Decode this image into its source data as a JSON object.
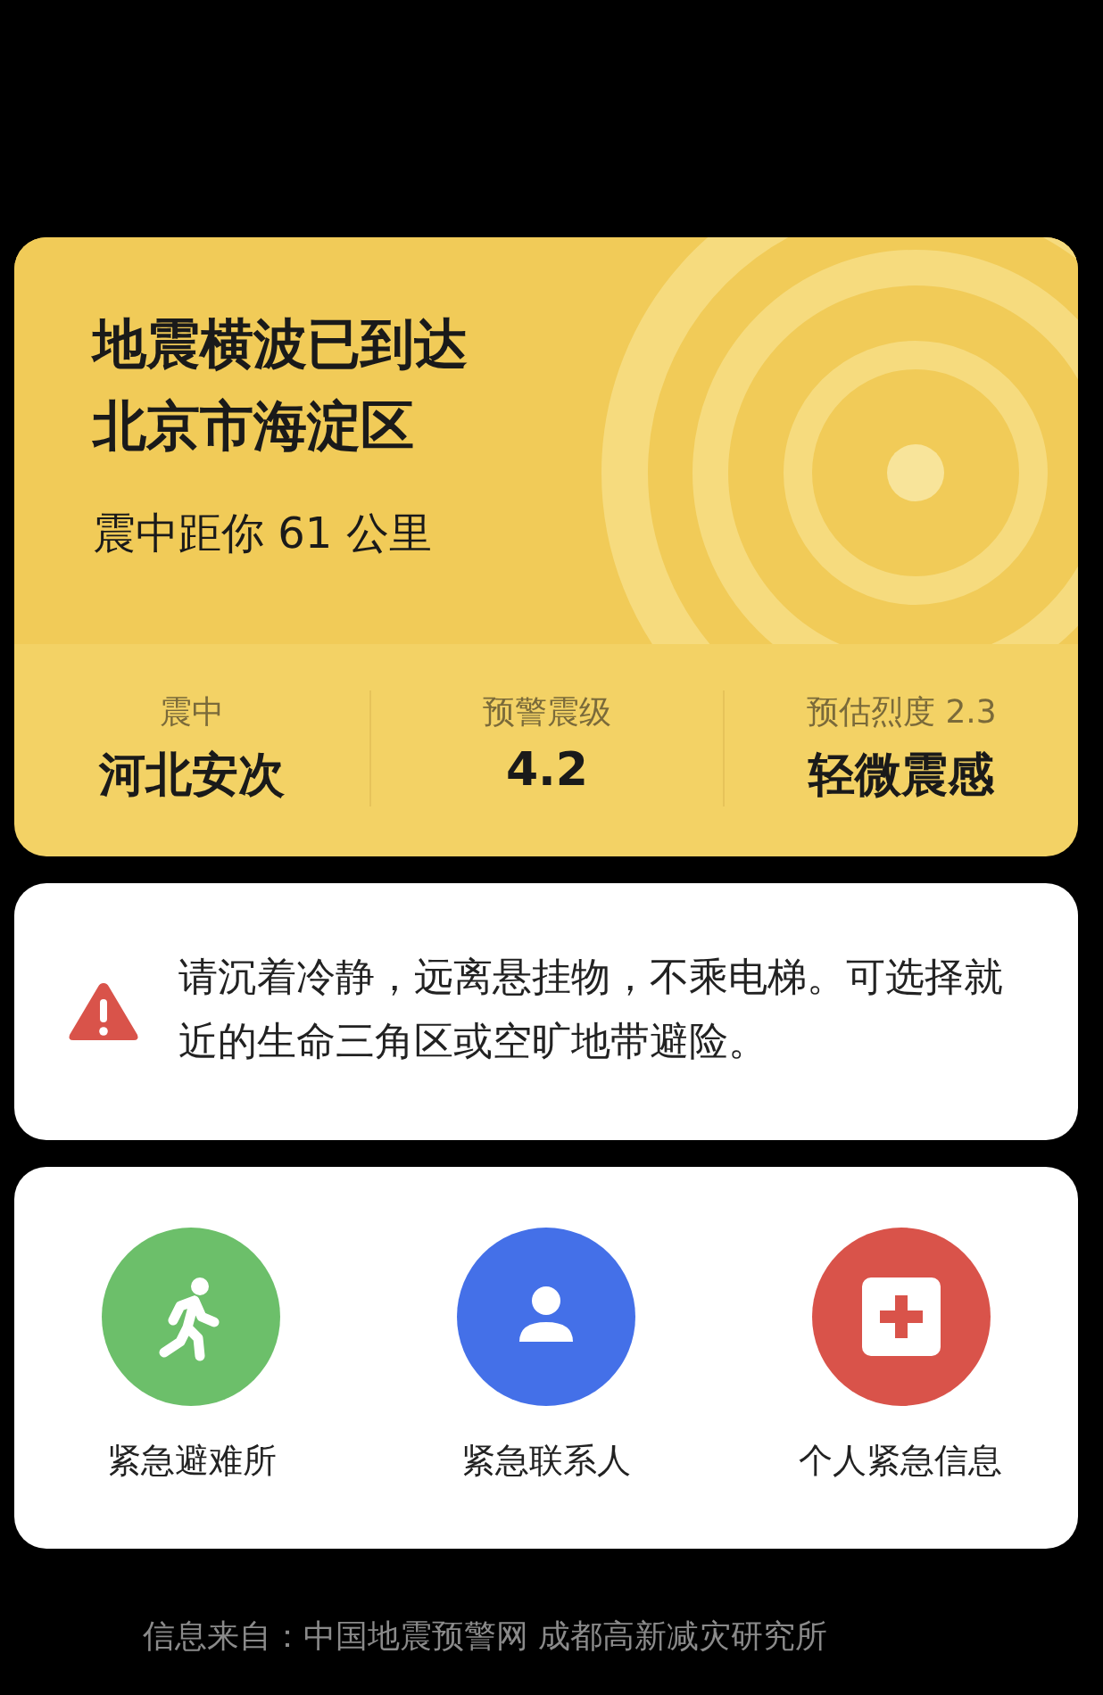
{
  "alert": {
    "title_lines": [
      "地震横波已到达",
      "北京市海淀区"
    ],
    "distance": "震中距你 61 公里",
    "stats": [
      {
        "label": "震中",
        "value": "河北安次"
      },
      {
        "label": "预警震级",
        "value": "4.2"
      },
      {
        "label": "预估烈度 2.3",
        "value": "轻微震感"
      }
    ]
  },
  "advice": {
    "text": "请沉着冷静，远离悬挂物，不乘电梯。可选择就近的生命三角区或空旷地带避险。"
  },
  "actions": [
    {
      "kind": "shelter",
      "label": "紧急避难所",
      "color": "#6cbf6a"
    },
    {
      "kind": "contact",
      "label": "紧急联系人",
      "color": "#4470e8"
    },
    {
      "kind": "medical",
      "label": "个人紧急信息",
      "color": "#d9534a"
    }
  ],
  "footer": "信息来自：中国地震预警网 成都高新减灾研究所"
}
